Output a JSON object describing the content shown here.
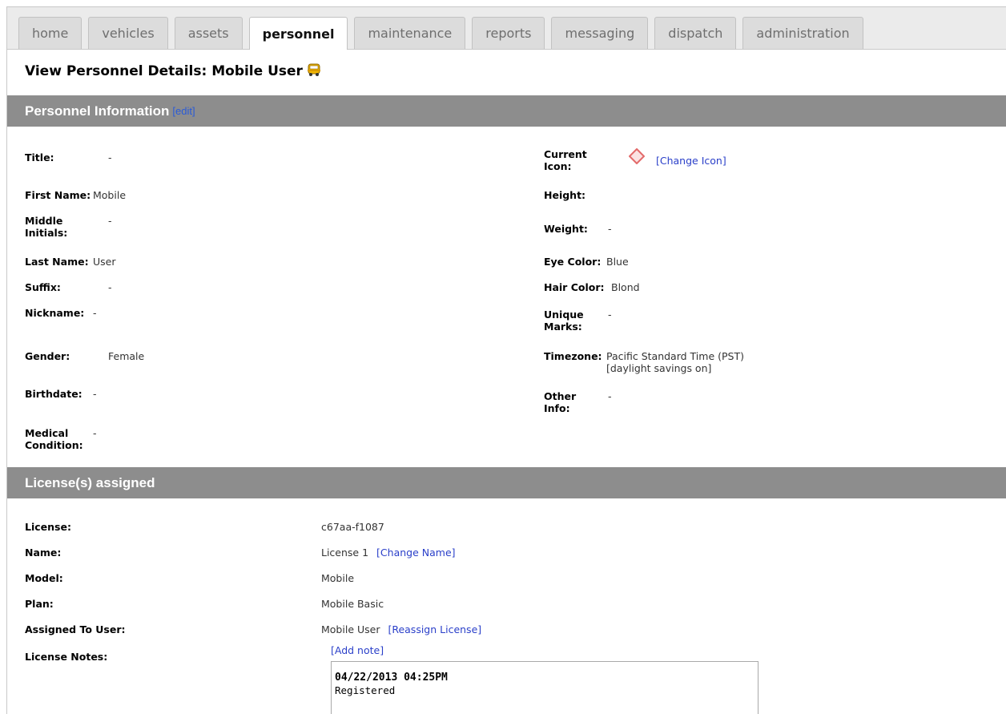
{
  "tabs": [
    {
      "label": "home",
      "active": false
    },
    {
      "label": "vehicles",
      "active": false
    },
    {
      "label": "assets",
      "active": false
    },
    {
      "label": "personnel",
      "active": true
    },
    {
      "label": "maintenance",
      "active": false
    },
    {
      "label": "reports",
      "active": false
    },
    {
      "label": "messaging",
      "active": false
    },
    {
      "label": "dispatch",
      "active": false
    },
    {
      "label": "administration",
      "active": false
    }
  ],
  "page": {
    "title": "View Personnel Details: Mobile User",
    "title_icon": "school-bus-icon"
  },
  "personnel_section": {
    "title": "Personnel Information",
    "edit_label": "[edit]",
    "left_fields": [
      {
        "label": "Title:",
        "value": "-"
      },
      {
        "label": "First Name:",
        "value": "Mobile"
      },
      {
        "label": "Middle Initials:",
        "value": "-"
      },
      {
        "label": "Last Name:",
        "value": "User"
      },
      {
        "label": "Suffix:",
        "value": "-"
      },
      {
        "label": "Nickname:",
        "value": "-"
      },
      {
        "label": "Gender:",
        "value": "Female"
      },
      {
        "label": "Birthdate:",
        "value": "-"
      },
      {
        "label": "Medical Condition:",
        "value": "-"
      }
    ],
    "right_fields": [
      {
        "label": "Current Icon:",
        "value": "[Change Icon]",
        "icon": "red-diamond-icon"
      },
      {
        "label": "Height:",
        "value": ""
      },
      {
        "label": "Weight:",
        "value": "-"
      },
      {
        "label": "Eye Color:",
        "value": "Blue"
      },
      {
        "label": "Hair Color:",
        "value": "Blond"
      },
      {
        "label": "Unique Marks:",
        "value": "-"
      },
      {
        "label": "Timezone:",
        "value": "Pacific Standard Time (PST)",
        "value2": "[daylight savings on]"
      },
      {
        "label": "Other Info:",
        "value": "-"
      }
    ]
  },
  "license_section": {
    "title": "License(s) assigned",
    "fields": [
      {
        "label": "License:",
        "value": "c67aa-f1087"
      },
      {
        "label": "Name:",
        "value": "License 1",
        "link": "[Change Name]"
      },
      {
        "label": "Model:",
        "value": "Mobile"
      },
      {
        "label": "Plan:",
        "value": "Mobile Basic"
      },
      {
        "label": "Assigned To User:",
        "value": "Mobile User",
        "link": "[Reassign License]"
      },
      {
        "label": "License Notes:",
        "value": "",
        "link": "[Add note]"
      }
    ],
    "notes": [
      {
        "date": "04/22/2013 04:25PM",
        "text": "Registered"
      }
    ]
  },
  "colors": {
    "section_header_bg": "#8d8d8d",
    "link": "#2a3fc9",
    "tab_bg": "#dcdcdc",
    "diamond": "#e36a6a"
  }
}
